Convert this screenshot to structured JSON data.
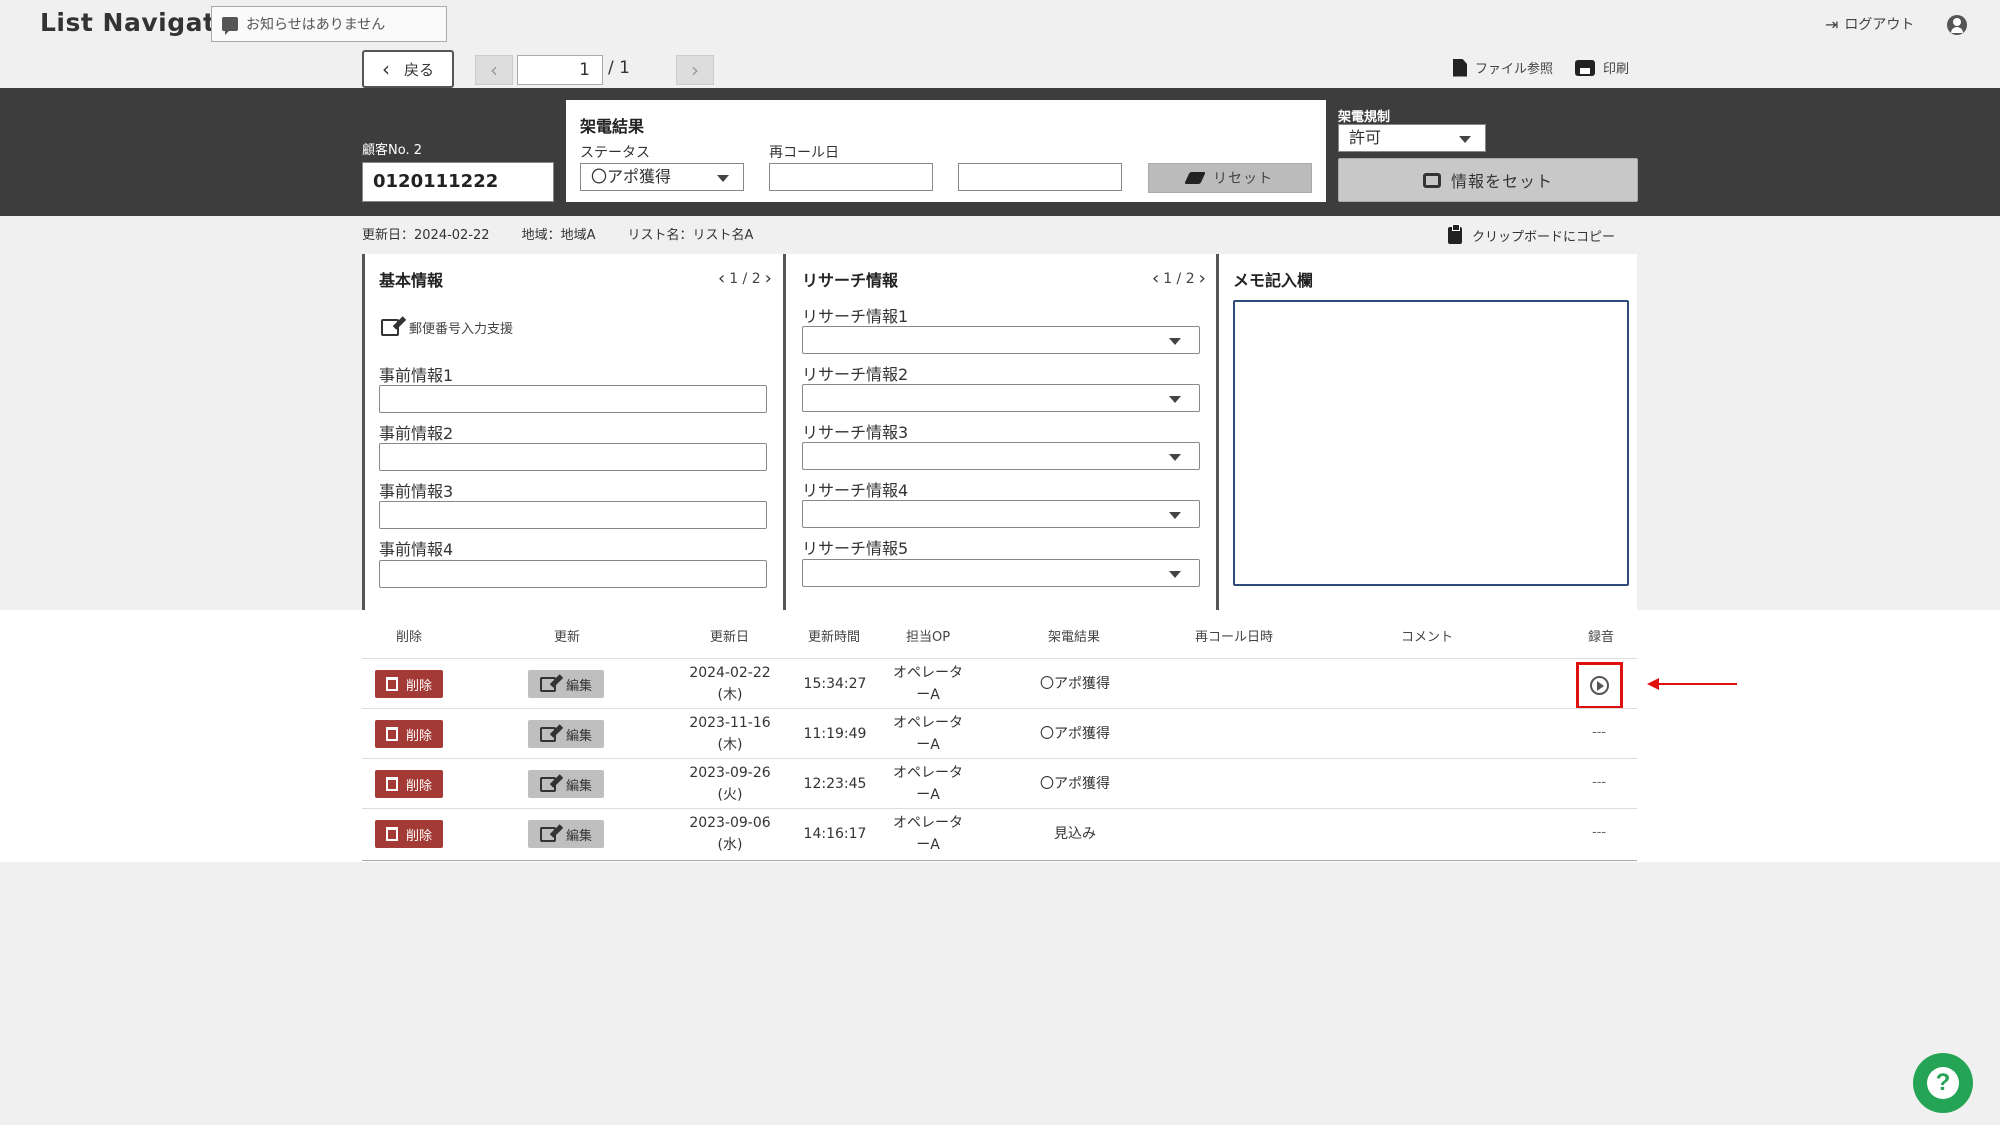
{
  "app": {
    "logo": "List Navigator."
  },
  "header": {
    "notice": "お知らせはありません",
    "logout": "ログアウト"
  },
  "nav": {
    "back": "戻る",
    "page_current": "1",
    "page_total": "/ 1",
    "file_ref": "ファイル参照",
    "print": "印刷"
  },
  "customer": {
    "label": "顧客No. 2",
    "phone": "0120111222"
  },
  "call_result": {
    "title": "架電結果",
    "status_label": "ステータス",
    "status_value": "〇アポ獲得",
    "recall_label": "再コール日",
    "reset": "リセット"
  },
  "regulation": {
    "label": "架電規制",
    "value": "許可"
  },
  "set_info": "情報をセット",
  "info_bar": {
    "updated": "更新日：2024-02-22",
    "region": "地域：地域A",
    "list_name": "リスト名：リスト名A",
    "clipboard": "クリップボードにコピー"
  },
  "basic": {
    "title": "基本情報",
    "pager": "1 / 2",
    "postal": "郵便番号入力支援",
    "fields": [
      "事前情報1",
      "事前情報2",
      "事前情報3",
      "事前情報4"
    ]
  },
  "research": {
    "title": "リサーチ情報",
    "pager": "1 / 2",
    "fields": [
      "リサーチ情報1",
      "リサーチ情報2",
      "リサーチ情報3",
      "リサーチ情報4",
      "リサーチ情報5"
    ]
  },
  "memo": {
    "title": "メモ記入欄"
  },
  "history": {
    "headers": {
      "delete": "削除",
      "update": "更新",
      "date": "更新日",
      "time": "更新時間",
      "op": "担当OP",
      "result": "架電結果",
      "recall": "再コール日時",
      "comment": "コメント",
      "recording": "録音"
    },
    "delete_label": "削除",
    "edit_label": "編集",
    "rows": [
      {
        "date": "2024-02-22",
        "dow": "(木)",
        "time": "15:34:27",
        "op1": "オペレータ",
        "op2": "ーA",
        "result": "〇アポ獲得",
        "recording": ""
      },
      {
        "date": "2023-11-16",
        "dow": "(木)",
        "time": "11:19:49",
        "op1": "オペレータ",
        "op2": "ーA",
        "result": "〇アポ獲得",
        "recording": "---"
      },
      {
        "date": "2023-09-26",
        "dow": "(火)",
        "time": "12:23:45",
        "op1": "オペレータ",
        "op2": "ーA",
        "result": "〇アポ獲得",
        "recording": "---"
      },
      {
        "date": "2023-09-06",
        "dow": "(水)",
        "time": "14:16:17",
        "op1": "オペレータ",
        "op2": "ーA",
        "result": "見込み",
        "recording": "---"
      }
    ]
  },
  "help": {
    "icon": "?"
  }
}
